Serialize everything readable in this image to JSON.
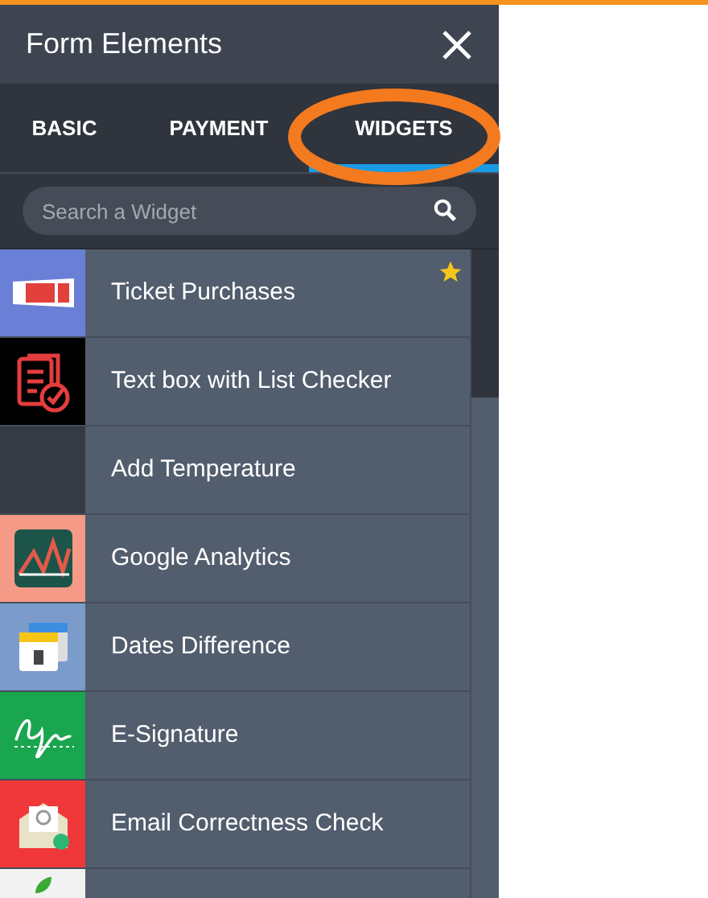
{
  "panel": {
    "title": "Form Elements"
  },
  "tabs": [
    {
      "label": "BASIC",
      "selected": false
    },
    {
      "label": "PAYMENT",
      "selected": false
    },
    {
      "label": "WIDGETS",
      "selected": true
    }
  ],
  "search": {
    "placeholder": "Search a Widget"
  },
  "widgets": [
    {
      "label": "Ticket Purchases",
      "kind": "ticket",
      "color": "#6a7fd6",
      "starred": true
    },
    {
      "label": "Text box with List Checker",
      "kind": "checklist",
      "color": "#000000",
      "starred": false
    },
    {
      "label": "Add Temperature",
      "kind": "blank",
      "color": "#353a44",
      "starred": false
    },
    {
      "label": "Google Analytics",
      "kind": "chart",
      "color": "#f49a86",
      "starred": false
    },
    {
      "label": "Dates Difference",
      "kind": "calendar",
      "color": "#7b9ccb",
      "starred": false
    },
    {
      "label": "E-Signature",
      "kind": "signature",
      "color": "#1aa54f",
      "starred": false
    },
    {
      "label": "Email Correctness Check",
      "kind": "email",
      "color": "#f0373a",
      "starred": false
    },
    {
      "kind": "leaf",
      "color": "#f2f2f2",
      "starred": false
    }
  ]
}
